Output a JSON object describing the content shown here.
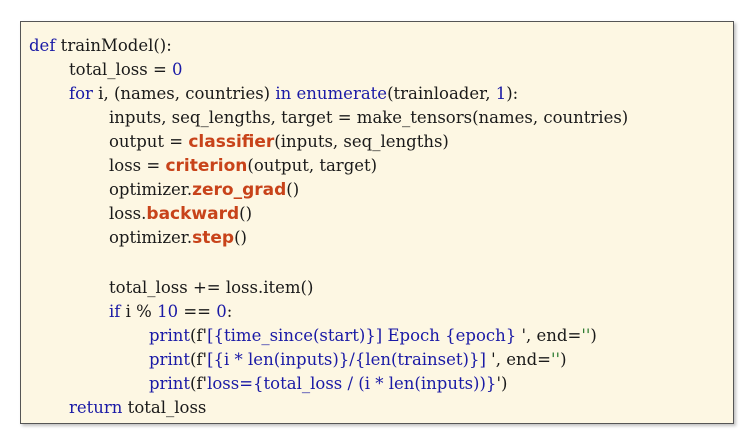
{
  "code": {
    "line1": {
      "kw": "def",
      "rest": " trainModel():"
    },
    "line2": {
      "text": "total_loss = ",
      "num": "0"
    },
    "line3": {
      "kw1": "for",
      "mid1": " i, (names, countries) ",
      "kw2": "in",
      "func": " enumerate",
      "mid2": "(trainloader, ",
      "num": "1",
      "end": "):"
    },
    "line4": {
      "text": "inputs, seq_lengths, target = make_tensors(names, countries)"
    },
    "line5": {
      "pre": "output = ",
      "hl": "classifier",
      "post": "(inputs, seq_lengths)"
    },
    "line6": {
      "pre": "loss = ",
      "hl": "criterion",
      "post": "(output, target)"
    },
    "line7": {
      "pre": "optimizer.",
      "hl": "zero_grad",
      "post": "()"
    },
    "line8": {
      "pre": "loss.",
      "hl": "backward",
      "post": "()"
    },
    "line9": {
      "pre": "optimizer.",
      "hl": "step",
      "post": "()"
    },
    "line10": {
      "text": "total_loss += loss.item()"
    },
    "line11": {
      "kw": "if",
      "mid": " i % ",
      "num1": "10",
      "mid2": " == ",
      "num2": "0",
      "end": ":"
    },
    "line12": {
      "fn": "print",
      "a": "(f'",
      "b": "[{time_since(start)}] Epoch {epoch} ",
      "c": "', end=",
      "d": "''",
      "e": ")"
    },
    "line13": {
      "fn": "print",
      "a": "(f'",
      "b": "[{i * len(inputs)}/{len(trainset)}] ",
      "c": "', end=",
      "d": "''",
      "e": ")"
    },
    "line14": {
      "fn": "print",
      "a": "(f'",
      "b": "loss={total_loss / (i * len(inputs))}",
      "c": "')"
    },
    "line15": {
      "kw": "return",
      "rest": " total_loss"
    }
  }
}
